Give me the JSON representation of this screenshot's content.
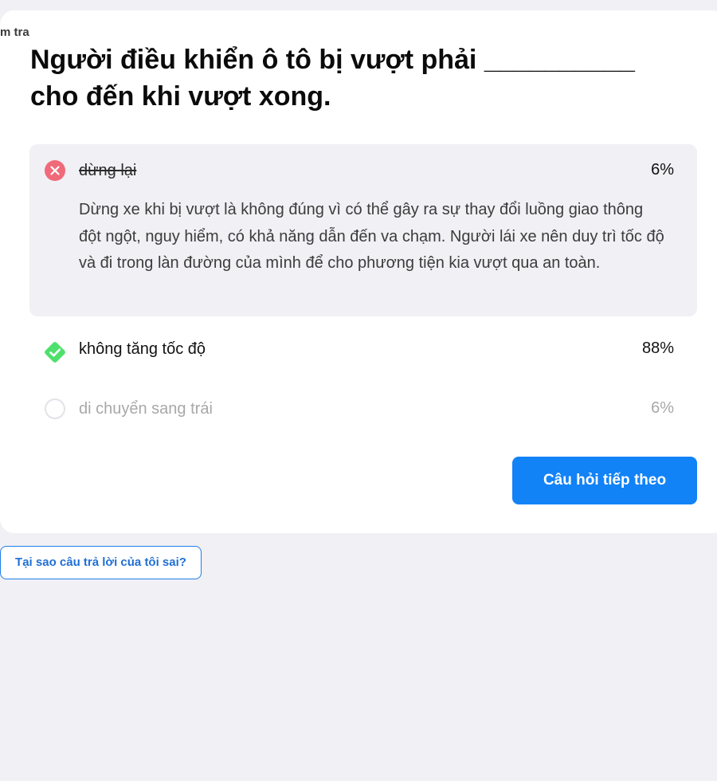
{
  "breadcrumb": {
    "text": "m tra"
  },
  "question": {
    "text": "Người điều khiển ô tô bị vượt phải __________ cho đến khi vượt xong."
  },
  "options": [
    {
      "label": "dừng lại",
      "percent": "6%",
      "state": "wrong",
      "icon": "x-circle-icon",
      "explanation": "Dừng xe khi bị vượt là không đúng vì có thể gây ra sự thay đổi luồng giao thông đột ngột, nguy hiểm, có khả năng dẫn đến va chạm. Người lái xe nên duy trì tốc độ và đi trong làn đường của mình để cho phương tiện kia vượt qua an toàn."
    },
    {
      "label": "không tăng tốc độ",
      "percent": "88%",
      "state": "correct",
      "icon": "check-diamond-icon"
    },
    {
      "label": "di chuyển sang trái",
      "percent": "6%",
      "state": "neutral",
      "icon": "empty-circle-icon"
    }
  ],
  "next_button": {
    "label": "Câu hỏi tiếp theo"
  },
  "why_link": {
    "label": "Tại sao câu trả lời của tôi sai?"
  },
  "colors": {
    "wrong": "#f06a79",
    "correct": "#4ee06c",
    "primary": "#1282f7",
    "explanation_bg": "#f0f0f5",
    "page_bg": "#f0f0f5"
  }
}
